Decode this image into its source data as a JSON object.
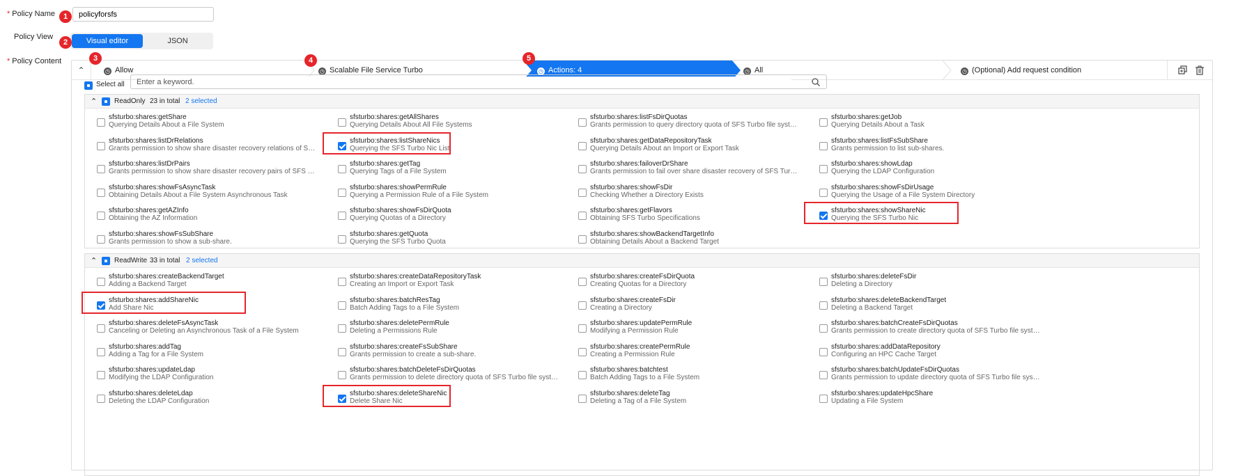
{
  "form": {
    "policy_name_label": "Policy Name",
    "policy_name_value": "policyforsfs",
    "policy_view_label": "Policy View",
    "view_options": [
      "Visual editor",
      "JSON"
    ],
    "policy_content_label": "Policy Content",
    "required_mark": "*"
  },
  "badges": [
    "1",
    "2",
    "3",
    "4",
    "5"
  ],
  "tabs": {
    "effect": "Allow",
    "service": "Scalable File Service Turbo",
    "actions": "Actions: 4",
    "resources": "All",
    "condition": "(Optional) Add request condition"
  },
  "toolbar_icons": [
    "copy-icon",
    "trash-icon"
  ],
  "select_all_label": "Select all",
  "search": {
    "placeholder": "Enter a keyword.",
    "value": ""
  },
  "groups": [
    {
      "name": "ReadOnly",
      "total": "23 in total",
      "selected": "2 selected",
      "items": [
        {
          "title": "sfsturbo:shares:getShare",
          "desc": "Querying Details About a File System",
          "checked": false
        },
        {
          "title": "sfsturbo:shares:getAllShares",
          "desc": "Querying Details About All File Systems",
          "checked": false
        },
        {
          "title": "sfsturbo:shares:listFsDirQuotas",
          "desc": "Grants permission to query directory quota of SFS Turbo file systems.",
          "checked": false
        },
        {
          "title": "sfsturbo:shares:getJob",
          "desc": "Querying Details About a Task",
          "checked": false
        },
        {
          "title": "sfsturbo:shares:listDrRelations",
          "desc": "Grants permission to show share disaster recovery relations of SFS Tur...",
          "checked": false
        },
        {
          "title": "sfsturbo:shares:listShareNics",
          "desc": "Querying the SFS Turbo Nic List",
          "checked": true
        },
        {
          "title": "sfsturbo:shares:getDataRepositoryTask",
          "desc": "Querying Details About an Import or Export Task",
          "checked": false
        },
        {
          "title": "sfsturbo:shares:listFsSubShare",
          "desc": "Grants permission to list sub-shares.",
          "checked": false
        },
        {
          "title": "sfsturbo:shares:listDrPairs",
          "desc": "Grants permission to show share disaster recovery pairs of SFS Turbo ...",
          "checked": false
        },
        {
          "title": "sfsturbo:shares:getTag",
          "desc": "Querying Tags of a File System",
          "checked": false
        },
        {
          "title": "sfsturbo:shares:failoverDrShare",
          "desc": "Grants permission to fail over share disaster recovery of SFS Turbo file...",
          "checked": false
        },
        {
          "title": "sfsturbo:shares:showLdap",
          "desc": "Querying the LDAP Configuration",
          "checked": false
        },
        {
          "title": "sfsturbo:shares:showFsAsyncTask",
          "desc": "Obtaining Details About a File System Asynchronous Task",
          "checked": false
        },
        {
          "title": "sfsturbo:shares:showPermRule",
          "desc": "Querying a Permission Rule of a File System",
          "checked": false
        },
        {
          "title": "sfsturbo:shares:showFsDir",
          "desc": "Checking Whether a Directory Exists",
          "checked": false
        },
        {
          "title": "sfsturbo:shares:showFsDirUsage",
          "desc": "Querying the Usage of a File System Directory",
          "checked": false
        },
        {
          "title": "sfsturbo:shares:getAZInfo",
          "desc": "Obtaining the AZ Information",
          "checked": false
        },
        {
          "title": "sfsturbo:shares:showFsDirQuota",
          "desc": "Querying Quotas of a Directory",
          "checked": false
        },
        {
          "title": "sfsturbo:shares:getFlavors",
          "desc": "Obtaining SFS Turbo Specifications",
          "checked": false
        },
        {
          "title": "sfsturbo:shares:showShareNic",
          "desc": "Querying the SFS Turbo Nic",
          "checked": true
        },
        {
          "title": "sfsturbo:shares:showFsSubShare",
          "desc": "Grants permission to show a sub-share.",
          "checked": false
        },
        {
          "title": "sfsturbo:shares:getQuota",
          "desc": "Querying the SFS Turbo Quota",
          "checked": false
        },
        {
          "title": "sfsturbo:shares:showBackendTargetInfo",
          "desc": "Obtaining Details About a Backend Target",
          "checked": false
        }
      ]
    },
    {
      "name": "ReadWrite",
      "total": "33 in total",
      "selected": "2 selected",
      "items": [
        {
          "title": "sfsturbo:shares:createBackendTarget",
          "desc": "Adding a Backend Target",
          "checked": false
        },
        {
          "title": "sfsturbo:shares:createDataRepositoryTask",
          "desc": "Creating an Import or Export Task",
          "checked": false
        },
        {
          "title": "sfsturbo:shares:createFsDirQuota",
          "desc": "Creating Quotas for a Directory",
          "checked": false
        },
        {
          "title": "sfsturbo:shares:deleteFsDir",
          "desc": "Deleting a Directory",
          "checked": false
        },
        {
          "title": "sfsturbo:shares:addShareNic",
          "desc": "Add Share Nic",
          "checked": true
        },
        {
          "title": "sfsturbo:shares:batchResTag",
          "desc": "Batch Adding Tags to a File System",
          "checked": false
        },
        {
          "title": "sfsturbo:shares:createFsDir",
          "desc": "Creating a Directory",
          "checked": false
        },
        {
          "title": "sfsturbo:shares:deleteBackendTarget",
          "desc": "Deleting a Backend Target",
          "checked": false
        },
        {
          "title": "sfsturbo:shares:deleteFsAsyncTask",
          "desc": "Canceling or Deleting an Asynchronous Task of a File System",
          "checked": false
        },
        {
          "title": "sfsturbo:shares:deletePermRule",
          "desc": "Deleting a Permissions Rule",
          "checked": false
        },
        {
          "title": "sfsturbo:shares:updatePermRule",
          "desc": "Modifying a Permission Rule",
          "checked": false
        },
        {
          "title": "sfsturbo:shares:batchCreateFsDirQuotas",
          "desc": "Grants permission to create directory quota of SFS Turbo file systems.",
          "checked": false
        },
        {
          "title": "sfsturbo:shares:addTag",
          "desc": "Adding a Tag for a File System",
          "checked": false
        },
        {
          "title": "sfsturbo:shares:createFsSubShare",
          "desc": "Grants permission to create a sub-share.",
          "checked": false
        },
        {
          "title": "sfsturbo:shares:createPermRule",
          "desc": "Creating a Permission Rule",
          "checked": false
        },
        {
          "title": "sfsturbo:shares:addDataRepository",
          "desc": "Configuring an HPC Cache Target",
          "checked": false
        },
        {
          "title": "sfsturbo:shares:updateLdap",
          "desc": "Modifying the LDAP Configuration",
          "checked": false
        },
        {
          "title": "sfsturbo:shares:batchDeleteFsDirQuotas",
          "desc": "Grants permission to delete directory quota of SFS Turbo file systems.",
          "checked": false
        },
        {
          "title": "sfsturbo:shares:batchtest",
          "desc": "Batch Adding Tags to a File System",
          "checked": false
        },
        {
          "title": "sfsturbo:shares:batchUpdateFsDirQuotas",
          "desc": "Grants permission to update directory quota of SFS Turbo file systems.",
          "checked": false
        },
        {
          "title": "sfsturbo:shares:deleteLdap",
          "desc": "Deleting the LDAP Configuration",
          "checked": false
        },
        {
          "title": "sfsturbo:shares:deleteShareNic",
          "desc": "Delete Share Nic",
          "checked": true
        },
        {
          "title": "sfsturbo:shares:deleteTag",
          "desc": "Deleting a Tag of a File System",
          "checked": false
        },
        {
          "title": "sfsturbo:shares:updateHpcShare",
          "desc": "Updating a File System",
          "checked": false
        }
      ]
    }
  ],
  "colors": {
    "accent": "#1476f0",
    "highlight": "#e5252a"
  }
}
